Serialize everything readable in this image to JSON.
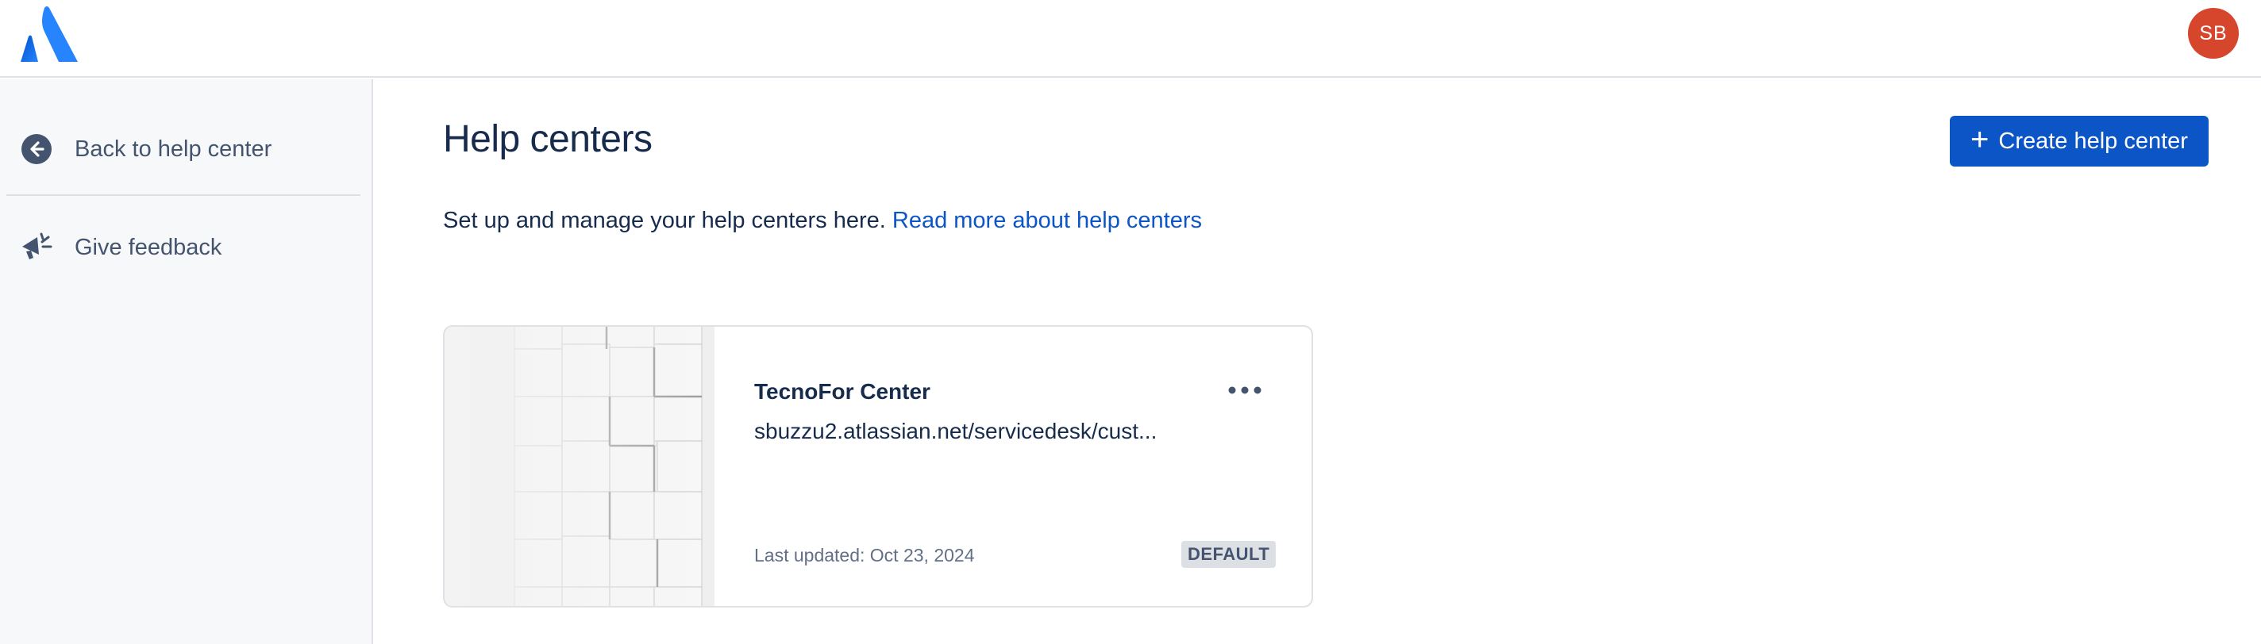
{
  "header": {
    "logo_icon": "atlassian-logo",
    "avatar_initials": "SB",
    "avatar_color": "#d5462d"
  },
  "sidebar": {
    "items": [
      {
        "label": "Back to help center",
        "icon": "arrow-left-circle-icon"
      },
      {
        "label": "Give feedback",
        "icon": "megaphone-icon"
      }
    ]
  },
  "main": {
    "title": "Help centers",
    "create_button_label": "Create help center",
    "intro_text": "Set up and manage your help centers here.",
    "intro_link": "Read more about help centers"
  },
  "help_centers": [
    {
      "name": "TecnoFor Center",
      "url": "sbuzzu2.atlassian.net/servicedesk/cust...",
      "last_updated": "Last updated: Oct 23, 2024",
      "badge": "DEFAULT"
    }
  ],
  "colors": {
    "primary": "#0c55c6",
    "text": "#172b4d",
    "subtle": "#626f86"
  }
}
